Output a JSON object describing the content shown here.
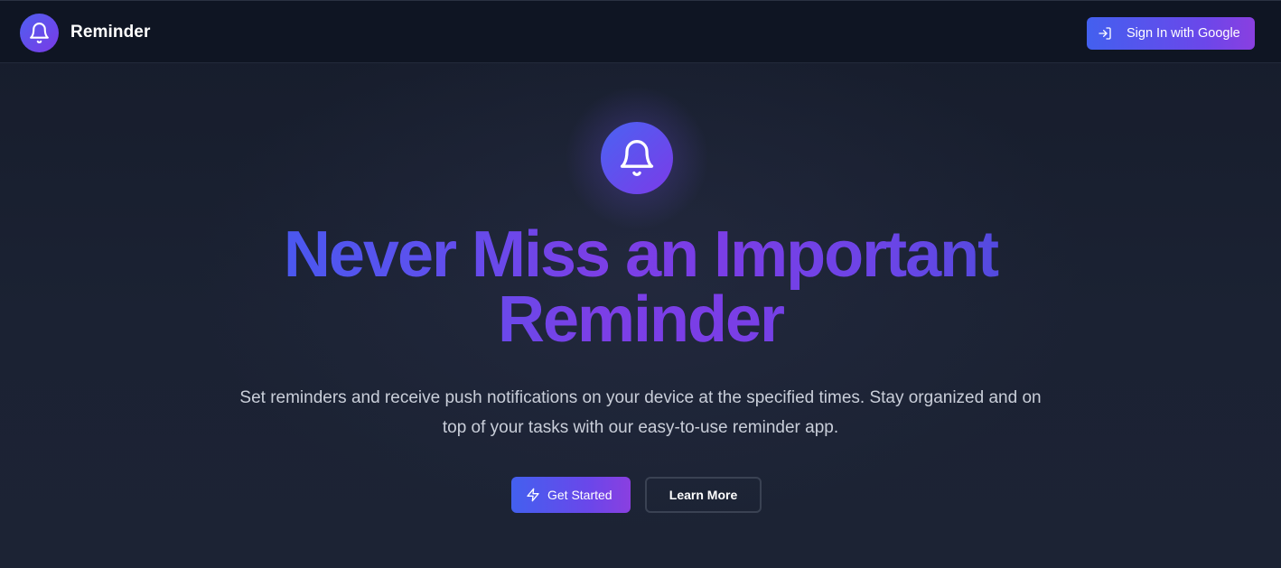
{
  "header": {
    "brand_name": "Reminder",
    "brand_icon": "bell-icon",
    "signin_label": "Sign In with Google",
    "signin_icon": "sign-in-icon"
  },
  "hero": {
    "icon": "bell-icon",
    "title": "Never Miss an Important Reminder",
    "subtitle": "Set reminders and receive push notifications on your device at the specified times. Stay organized and on top of your tasks with our easy-to-use reminder app.",
    "primary_cta": "Get Started",
    "primary_cta_icon": "lightning-icon",
    "secondary_cta": "Learn More"
  },
  "colors": {
    "background": "#1a2030",
    "header_background": "#0f1523",
    "accent_blue": "#4360ef",
    "accent_purple": "#7b3fe6",
    "subtitle_text": "#c9ced9",
    "outline_border": "#3a4253"
  }
}
